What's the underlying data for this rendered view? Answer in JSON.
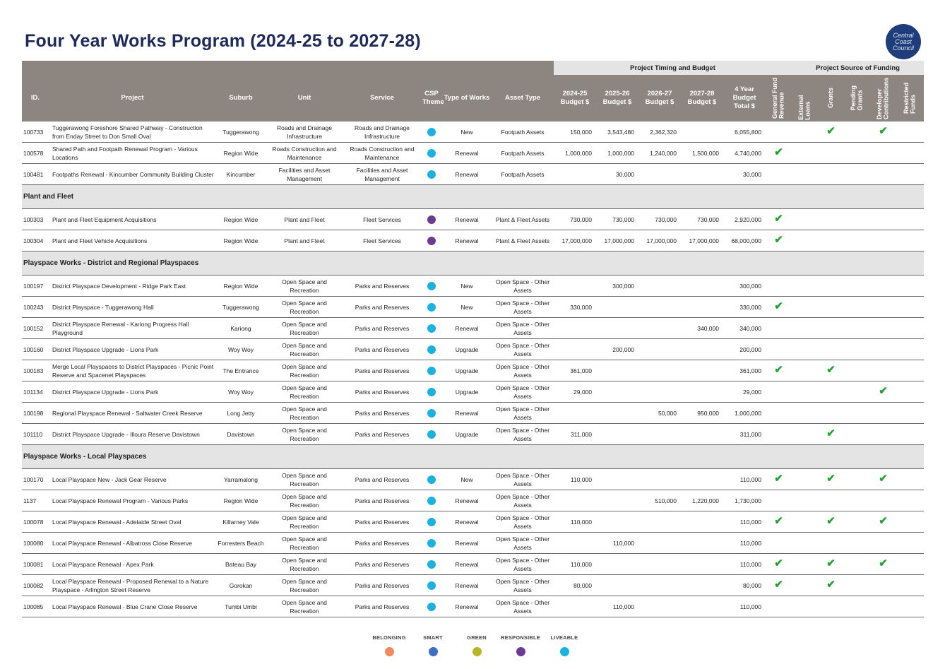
{
  "title": "Four Year Works Program (2024-25 to 2027-28)",
  "logo_text": "Central\nCoast\nCouncil",
  "group_headers": {
    "timing": "Project Timing and Budget",
    "funding": "Project Source of Funding"
  },
  "columns": {
    "id": "ID.",
    "project": "Project",
    "suburb": "Suburb",
    "unit": "Unit",
    "service": "Service",
    "csp": "CSP Theme",
    "type": "Type of Works",
    "asset": "Asset Type",
    "b2425": "2024-25 Budget $",
    "b2526": "2025-26 Budget $",
    "b2627": "2026-27 Budget $",
    "b2728": "2027-28 Budget $",
    "total": "4 Year Budget Total $",
    "f_general": "General Fund\nRevenue",
    "f_loans": "External Loans",
    "f_grants": "Grants",
    "f_pending": "Pending\nGrants",
    "f_developer": "Developer\nContributions",
    "f_restricted": "Restricted\nFunds"
  },
  "theme_colors": {
    "liveable": "#1ab2e0",
    "responsible": "#6b3a96"
  },
  "tick": "✔",
  "rows": [
    {
      "kind": "row",
      "id": "100733",
      "project": "Tuggerawong Foreshore Shared Pathway - Construction from Enday Street to Don Small Oval",
      "suburb": "Tuggerawong",
      "unit": "Roads and Drainage Infrastructure",
      "service": "Roads and Drainage Infrastructure",
      "theme": "liveable",
      "type": "New",
      "asset": "Footpath Assets",
      "b2425": "150,000",
      "b2526": "3,543,480",
      "b2627": "2,362,320",
      "b2728": "",
      "total": "6,055,800",
      "funds": [
        false,
        false,
        true,
        false,
        true,
        false
      ]
    },
    {
      "kind": "row",
      "id": "100578",
      "project": "Shared Path and Footpath Renewal Program - Various Locations",
      "suburb": "Region Wide",
      "unit": "Roads Construction and Maintenance",
      "service": "Roads Construction and Maintenance",
      "theme": "liveable",
      "type": "Renewal",
      "asset": "Footpath Assets",
      "b2425": "1,000,000",
      "b2526": "1,000,000",
      "b2627": "1,240,000",
      "b2728": "1,500,000",
      "total": "4,740,000",
      "funds": [
        true,
        false,
        false,
        false,
        false,
        false
      ]
    },
    {
      "kind": "row",
      "id": "100481",
      "project": "Footpaths Renewal - Kincumber Community Building Cluster",
      "suburb": "Kincumber",
      "unit": "Facilities and Asset Management",
      "service": "Facilities and Asset Management",
      "theme": "liveable",
      "type": "Renewal",
      "asset": "Footpath Assets",
      "b2425": "",
      "b2526": "30,000",
      "b2627": "",
      "b2728": "",
      "total": "30,000",
      "funds": [
        false,
        false,
        false,
        false,
        false,
        false
      ]
    },
    {
      "kind": "section",
      "label": "Plant and Fleet"
    },
    {
      "kind": "row",
      "id": "100303",
      "project": "Plant and Fleet Equipment Acquisitions",
      "suburb": "Region Wide",
      "unit": "Plant and Fleet",
      "service": "Fleet Services",
      "theme": "responsible",
      "type": "Renewal",
      "asset": "Plant & Fleet Assets",
      "b2425": "730,000",
      "b2526": "730,000",
      "b2627": "730,000",
      "b2728": "730,000",
      "total": "2,920,000",
      "funds": [
        true,
        false,
        false,
        false,
        false,
        false
      ]
    },
    {
      "kind": "row",
      "id": "100304",
      "project": "Plant and Fleet Vehicle Acquisitions",
      "suburb": "Region Wide",
      "unit": "Plant and Fleet",
      "service": "Fleet Services",
      "theme": "responsible",
      "type": "Renewal",
      "asset": "Plant & Fleet Assets",
      "b2425": "17,000,000",
      "b2526": "17,000,000",
      "b2627": "17,000,000",
      "b2728": "17,000,000",
      "total": "68,000,000",
      "funds": [
        true,
        false,
        false,
        false,
        false,
        false
      ]
    },
    {
      "kind": "section",
      "label": "Playspace Works - District and Regional Playspaces"
    },
    {
      "kind": "row",
      "id": "100197",
      "project": "District Playspace Development - Ridge Park East",
      "suburb": "Region Wide",
      "unit": "Open Space and Recreation",
      "service": "Parks and Reserves",
      "theme": "liveable",
      "type": "New",
      "asset": "Open Space - Other Assets",
      "b2425": "",
      "b2526": "300,000",
      "b2627": "",
      "b2728": "",
      "total": "300,000",
      "funds": [
        false,
        false,
        false,
        false,
        false,
        false
      ]
    },
    {
      "kind": "row",
      "id": "100243",
      "project": "District Playspace - Tuggerawong Hall",
      "suburb": "Tuggerawong",
      "unit": "Open Space and Recreation",
      "service": "Parks and Reserves",
      "theme": "liveable",
      "type": "New",
      "asset": "Open Space - Other Assets",
      "b2425": "330,000",
      "b2526": "",
      "b2627": "",
      "b2728": "",
      "total": "330,000",
      "funds": [
        true,
        false,
        false,
        false,
        false,
        false
      ]
    },
    {
      "kind": "row",
      "id": "100152",
      "project": "District Playspace Renewal - Kariong Progress Hall Playground",
      "suburb": "Kariong",
      "unit": "Open Space and Recreation",
      "service": "Parks and Reserves",
      "theme": "liveable",
      "type": "Renewal",
      "asset": "Open Space - Other Assets",
      "b2425": "",
      "b2526": "",
      "b2627": "",
      "b2728": "340,000",
      "total": "340,000",
      "funds": [
        false,
        false,
        false,
        false,
        false,
        false
      ]
    },
    {
      "kind": "row",
      "id": "100160",
      "project": "District Playspace Upgrade - Lions Park",
      "suburb": "Woy Woy",
      "unit": "Open Space and Recreation",
      "service": "Parks and Reserves",
      "theme": "liveable",
      "type": "Upgrade",
      "asset": "Open Space - Other Assets",
      "b2425": "",
      "b2526": "200,000",
      "b2627": "",
      "b2728": "",
      "total": "200,000",
      "funds": [
        false,
        false,
        false,
        false,
        false,
        false
      ]
    },
    {
      "kind": "row",
      "id": "100183",
      "project": "Merge Local Playspaces to District Playspaces - Picnic Point Reserve and Spacenet Playspaces",
      "suburb": "The Entrance",
      "unit": "Open Space and Recreation",
      "service": "Parks and Reserves",
      "theme": "liveable",
      "type": "Upgrade",
      "asset": "Open Space - Other Assets",
      "b2425": "361,000",
      "b2526": "",
      "b2627": "",
      "b2728": "",
      "total": "361,000",
      "funds": [
        true,
        false,
        true,
        false,
        false,
        false
      ]
    },
    {
      "kind": "row",
      "id": "101134",
      "project": "District Playspace Upgrade - Lions Park",
      "suburb": "Woy Woy",
      "unit": "Open Space and Recreation",
      "service": "Parks and Reserves",
      "theme": "liveable",
      "type": "Upgrade",
      "asset": "Open Space - Other Assets",
      "b2425": "29,000",
      "b2526": "",
      "b2627": "",
      "b2728": "",
      "total": "29,000",
      "funds": [
        false,
        false,
        false,
        false,
        true,
        false
      ]
    },
    {
      "kind": "row",
      "id": "100198",
      "project": "Regional Playspace Renewal - Saltwater Creek Reserve",
      "suburb": "Long Jetty",
      "unit": "Open Space and Recreation",
      "service": "Parks and Reserves",
      "theme": "liveable",
      "type": "Renewal",
      "asset": "Open Space - Other Assets",
      "b2425": "",
      "b2526": "",
      "b2627": "50,000",
      "b2728": "950,000",
      "total": "1,000,000",
      "funds": [
        false,
        false,
        false,
        false,
        false,
        false
      ]
    },
    {
      "kind": "row",
      "id": "101110",
      "project": "District Playspace Upgrade - Illoura Reserve Davistown",
      "suburb": "Davistown",
      "unit": "Open Space and Recreation",
      "service": "Parks and Reserves",
      "theme": "liveable",
      "type": "Upgrade",
      "asset": "Open Space - Other Assets",
      "b2425": "311,000",
      "b2526": "",
      "b2627": "",
      "b2728": "",
      "total": "311,000",
      "funds": [
        false,
        false,
        true,
        false,
        false,
        false
      ]
    },
    {
      "kind": "section",
      "label": "Playspace Works - Local Playspaces"
    },
    {
      "kind": "row",
      "id": "100170",
      "project": "Local Playspace New - Jack Gear Reserve",
      "suburb": "Yarramalong",
      "unit": "Open Space and Recreation",
      "service": "Parks and Reserves",
      "theme": "liveable",
      "type": "New",
      "asset": "Open Space - Other Assets",
      "b2425": "110,000",
      "b2526": "",
      "b2627": "",
      "b2728": "",
      "total": "110,000",
      "funds": [
        true,
        false,
        true,
        false,
        true,
        false
      ]
    },
    {
      "kind": "row",
      "id": "1137",
      "project": "Local Playspace Renewal Program - Various Parks",
      "suburb": "Region Wide",
      "unit": "Open Space and Recreation",
      "service": "Parks and Reserves",
      "theme": "liveable",
      "type": "Renewal",
      "asset": "Open Space - Other Assets",
      "b2425": "",
      "b2526": "",
      "b2627": "510,000",
      "b2728": "1,220,000",
      "total": "1,730,000",
      "funds": [
        false,
        false,
        false,
        false,
        false,
        false
      ]
    },
    {
      "kind": "row",
      "id": "100078",
      "project": "Local Playspace Renewal - Adelaide Street Oval",
      "suburb": "Killarney Vale",
      "unit": "Open Space and Recreation",
      "service": "Parks and Reserves",
      "theme": "liveable",
      "type": "Renewal",
      "asset": "Open Space - Other Assets",
      "b2425": "110,000",
      "b2526": "",
      "b2627": "",
      "b2728": "",
      "total": "110,000",
      "funds": [
        true,
        false,
        true,
        false,
        true,
        false
      ]
    },
    {
      "kind": "row",
      "id": "100080",
      "project": "Local Playspace Renewal - Albatross Close Reserve",
      "suburb": "Forresters Beach",
      "unit": "Open Space and Recreation",
      "service": "Parks and Reserves",
      "theme": "liveable",
      "type": "Renewal",
      "asset": "Open Space - Other Assets",
      "b2425": "",
      "b2526": "110,000",
      "b2627": "",
      "b2728": "",
      "total": "110,000",
      "funds": [
        false,
        false,
        false,
        false,
        false,
        false
      ]
    },
    {
      "kind": "row",
      "id": "100081",
      "project": "Local Playspace Renewal - Apex Park",
      "suburb": "Bateau Bay",
      "unit": "Open Space and Recreation",
      "service": "Parks and Reserves",
      "theme": "liveable",
      "type": "Renewal",
      "asset": "Open Space - Other Assets",
      "b2425": "110,000",
      "b2526": "",
      "b2627": "",
      "b2728": "",
      "total": "110,000",
      "funds": [
        true,
        false,
        true,
        false,
        true,
        false
      ]
    },
    {
      "kind": "row",
      "id": "100082",
      "project": "Local Playspace Renewal - Proposed Renewal to a Nature Playspace - Arlington Street Reserve",
      "suburb": "Gorokan",
      "unit": "Open Space and Recreation",
      "service": "Parks and Reserves",
      "theme": "liveable",
      "type": "Renewal",
      "asset": "Open Space - Other Assets",
      "b2425": "80,000",
      "b2526": "",
      "b2627": "",
      "b2728": "",
      "total": "80,000",
      "funds": [
        true,
        false,
        true,
        false,
        false,
        false
      ]
    },
    {
      "kind": "row",
      "id": "100085",
      "project": "Local Playspace Renewal - Blue Crane Close Reserve",
      "suburb": "Tumbi Umbi",
      "unit": "Open Space and Recreation",
      "service": "Parks and Reserves",
      "theme": "liveable",
      "type": "Renewal",
      "asset": "Open Space - Other Assets",
      "b2425": "",
      "b2526": "110,000",
      "b2627": "",
      "b2728": "",
      "total": "110,000",
      "funds": [
        false,
        false,
        false,
        false,
        false,
        false
      ]
    }
  ],
  "legend": [
    {
      "label": "BELONGING",
      "color": "#f08a5d"
    },
    {
      "label": "SMART",
      "color": "#3a6fc4"
    },
    {
      "label": "GREEN",
      "color": "#b8b52a"
    },
    {
      "label": "RESPONSIBLE",
      "color": "#6b3a96"
    },
    {
      "label": "LIVEABLE",
      "color": "#1ab2e0"
    }
  ]
}
